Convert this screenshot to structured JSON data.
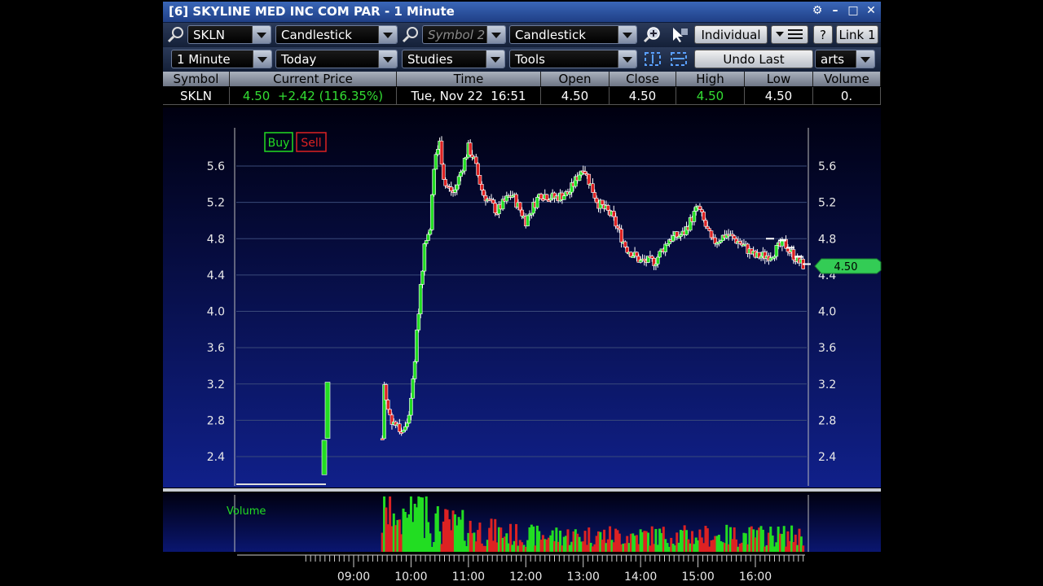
{
  "window": {
    "title": "[6] SKYLINE MED INC COM PAR - 1 Minute"
  },
  "toolbar1": {
    "symbol": "SKLN",
    "chart_type": "Candlestick",
    "symbol2_placeholder": "Symbol 2",
    "chart_type2": "Candlestick",
    "individual_label": "Individual",
    "help_label": "?",
    "link_label": "Link 1"
  },
  "toolbar2": {
    "interval": "1 Minute",
    "range": "Today",
    "studies": "Studies",
    "tools": "Tools",
    "undo_label": "Undo Last",
    "charts_label": "arts"
  },
  "quote": {
    "headers": [
      "Symbol",
      "Current Price",
      "Time",
      "Open",
      "Close",
      "High",
      "Low",
      "Volume"
    ],
    "symbol": "SKLN",
    "price": "4.50",
    "change": "+2.42 (116.35%)",
    "time": "Tue, Nov 22  16:51",
    "open": "4.50",
    "close": "4.50",
    "high": "4.50",
    "low": "4.50",
    "volume": "0."
  },
  "legend": {
    "buy": "Buy",
    "sell": "Sell",
    "volume": "Volume"
  },
  "price_tag": "4.50",
  "colors": {
    "up": "#22dd22",
    "down": "#dd2222",
    "tag": "#33cc55",
    "title_blue": "#2a52a6"
  },
  "chart_data": {
    "type": "candlestick",
    "y_ticks": [
      "5.6",
      "5.2",
      "4.8",
      "4.4",
      "4.0",
      "3.6",
      "3.2",
      "2.8",
      "2.4"
    ],
    "x_ticks": [
      "09:00",
      "10:00",
      "11:00",
      "12:00",
      "13:00",
      "14:00",
      "15:00",
      "16:00"
    ],
    "ylim": [
      2.0,
      6.0
    ],
    "last_price": 4.5,
    "close_path": [
      [
        "09:00",
        2.1
      ],
      [
        "09:30",
        2.6
      ],
      [
        "09:32",
        3.2
      ],
      [
        "09:35",
        2.95
      ],
      [
        "09:40",
        2.8
      ],
      [
        "09:50",
        2.68
      ],
      [
        "09:55",
        2.72
      ],
      [
        "10:00",
        3.0
      ],
      [
        "10:05",
        3.6
      ],
      [
        "10:10",
        4.3
      ],
      [
        "10:15",
        4.8
      ],
      [
        "10:20",
        4.95
      ],
      [
        "10:25",
        5.7
      ],
      [
        "10:30",
        5.85
      ],
      [
        "10:35",
        5.4
      ],
      [
        "10:45",
        5.3
      ],
      [
        "11:00",
        5.8
      ],
      [
        "11:05",
        5.7
      ],
      [
        "11:15",
        5.3
      ],
      [
        "11:30",
        5.1
      ],
      [
        "11:45",
        5.3
      ],
      [
        "12:00",
        5.0
      ],
      [
        "12:15",
        5.3
      ],
      [
        "12:30",
        5.25
      ],
      [
        "12:45",
        5.3
      ],
      [
        "13:00",
        5.6
      ],
      [
        "13:15",
        5.2
      ],
      [
        "13:30",
        5.05
      ],
      [
        "13:45",
        4.7
      ],
      [
        "14:00",
        4.55
      ],
      [
        "14:15",
        4.55
      ],
      [
        "14:30",
        4.8
      ],
      [
        "14:45",
        4.85
      ],
      [
        "15:00",
        5.15
      ],
      [
        "15:15",
        4.75
      ],
      [
        "15:30",
        4.85
      ],
      [
        "15:45",
        4.75
      ],
      [
        "16:00",
        4.6
      ],
      [
        "16:15",
        4.62
      ],
      [
        "16:30",
        4.75
      ],
      [
        "16:45",
        4.55
      ],
      [
        "16:51",
        4.5
      ]
    ]
  }
}
